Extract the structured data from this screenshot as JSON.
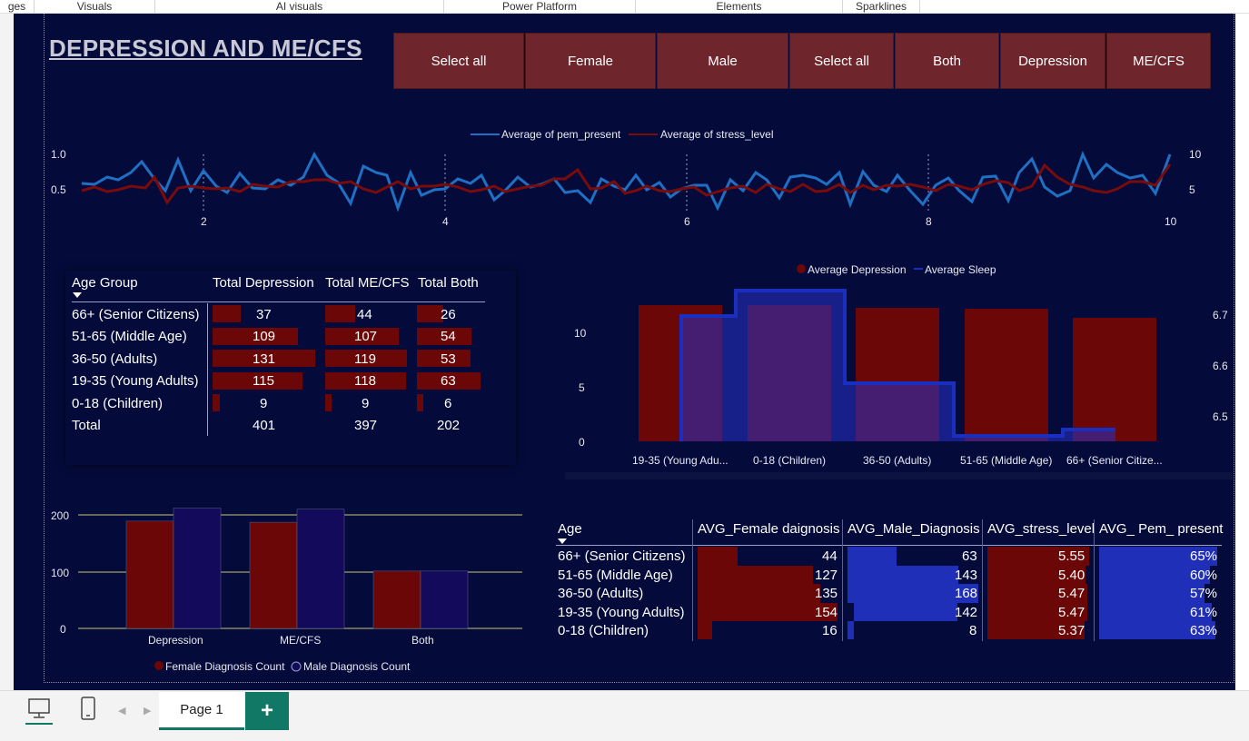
{
  "ribbon": {
    "groups": [
      "ges",
      "Visuals",
      "AI visuals",
      "Power Platform",
      "Elements",
      "Sparklines"
    ]
  },
  "report": {
    "title": "DEPRESSION AND ME/CFS"
  },
  "slicers": {
    "gender": [
      "Select all",
      "Female",
      "Male"
    ],
    "diagnosis": [
      "Select all",
      "Both",
      "Depression",
      "ME/CFS"
    ]
  },
  "line_chart": {
    "legend": [
      "Average of pem_present",
      "Average of stress_level"
    ],
    "colors": {
      "pem": "#1f6fc2",
      "stress": "#7a0b0b"
    },
    "y_left_ticks": [
      "1.0",
      "0.5"
    ],
    "y_right_ticks": [
      "10",
      "5"
    ],
    "x_ticks": [
      "2",
      "4",
      "6",
      "8",
      "10"
    ]
  },
  "age_table": {
    "headers": [
      "Age Group",
      "Total Depression",
      "Total ME/CFS",
      "Total Both"
    ],
    "rows": [
      {
        "age": "66+ (Senior Citizens)",
        "dep": "37",
        "me": "44",
        "both": "26"
      },
      {
        "age": "51-65 (Middle Age)",
        "dep": "109",
        "me": "107",
        "both": "54"
      },
      {
        "age": "36-50 (Adults)",
        "dep": "131",
        "me": "119",
        "both": "53"
      },
      {
        "age": "19-35 (Young Adults)",
        "dep": "115",
        "me": "118",
        "both": "63"
      },
      {
        "age": "0-18 (Children)",
        "dep": "9",
        "me": "9",
        "both": "6"
      }
    ],
    "total": {
      "label": "Total",
      "dep": "401",
      "me": "397",
      "both": "202"
    }
  },
  "combo_chart": {
    "legend": [
      "Average Depression",
      "Average Sleep"
    ],
    "colors": {
      "depression": "#6b0707",
      "sleep": "#1a2fc0"
    },
    "y_left_ticks": [
      "10",
      "5",
      "0"
    ],
    "y_right_ticks": [
      "6.7",
      "6.6",
      "6.5"
    ],
    "categories": [
      "19-35 (Young Adu...",
      "0-18 (Children)",
      "36-50 (Adults)",
      "51-65 (Middle Age)",
      "66+ (Senior Citize..."
    ]
  },
  "diag_chart": {
    "type": "bar",
    "categories": [
      "Depression",
      "ME/CFS",
      "Both"
    ],
    "series": [
      {
        "name": "Female Diagnosis Count",
        "values": [
          189,
          187,
          101
        ]
      },
      {
        "name": "Male Diagnosis Count",
        "values": [
          212,
          210,
          101
        ]
      }
    ],
    "y_ticks": [
      "200",
      "100",
      "0"
    ],
    "ylim": [
      0,
      230
    ],
    "colors": {
      "female": "#6b0707",
      "male": "#140a5c"
    }
  },
  "avg_table": {
    "headers": [
      "Age",
      "AVG_Female daignosis",
      "AVG_Male_Diagnosis",
      "AVG_stress_level",
      "AVG_ Pem_ present"
    ],
    "rows": [
      {
        "age": "66+ (Senior Citizens)",
        "f": "44",
        "m": "63",
        "s": "5.55",
        "p": "65%"
      },
      {
        "age": "51-65 (Middle Age)",
        "f": "127",
        "m": "143",
        "s": "5.40",
        "p": "60%"
      },
      {
        "age": "36-50 (Adults)",
        "f": "135",
        "m": "168",
        "s": "5.47",
        "p": "57%"
      },
      {
        "age": "19-35 (Young Adults)",
        "f": "154",
        "m": "142",
        "s": "5.47",
        "p": "61%"
      },
      {
        "age": "0-18 (Children)",
        "f": "16",
        "m": "8",
        "s": "5.37",
        "p": "63%"
      }
    ]
  },
  "bottom": {
    "page_tab": "Page 1",
    "add_label": "+"
  }
}
